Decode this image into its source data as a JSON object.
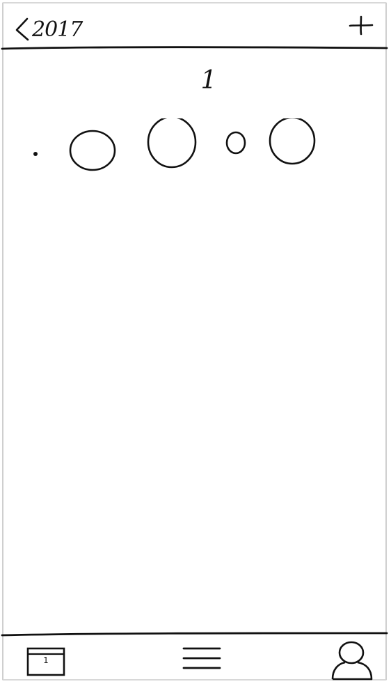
{
  "header": {
    "back_label": "2017",
    "back_icon": "chevron-left-icon",
    "add_icon": "plus-icon"
  },
  "main": {
    "month_number": "1",
    "days": [
      {
        "size": "dot"
      },
      {
        "size": "medium"
      },
      {
        "size": "large"
      },
      {
        "size": "small"
      },
      {
        "size": "medium-large"
      }
    ]
  },
  "tab_bar": {
    "calendar_day": "1",
    "tabs": [
      {
        "icon": "calendar-icon"
      },
      {
        "icon": "menu-icon"
      },
      {
        "icon": "profile-icon"
      }
    ]
  },
  "colors": {
    "ink": "#111111",
    "paper": "#ffffff",
    "frame": "#cfcfcf"
  }
}
